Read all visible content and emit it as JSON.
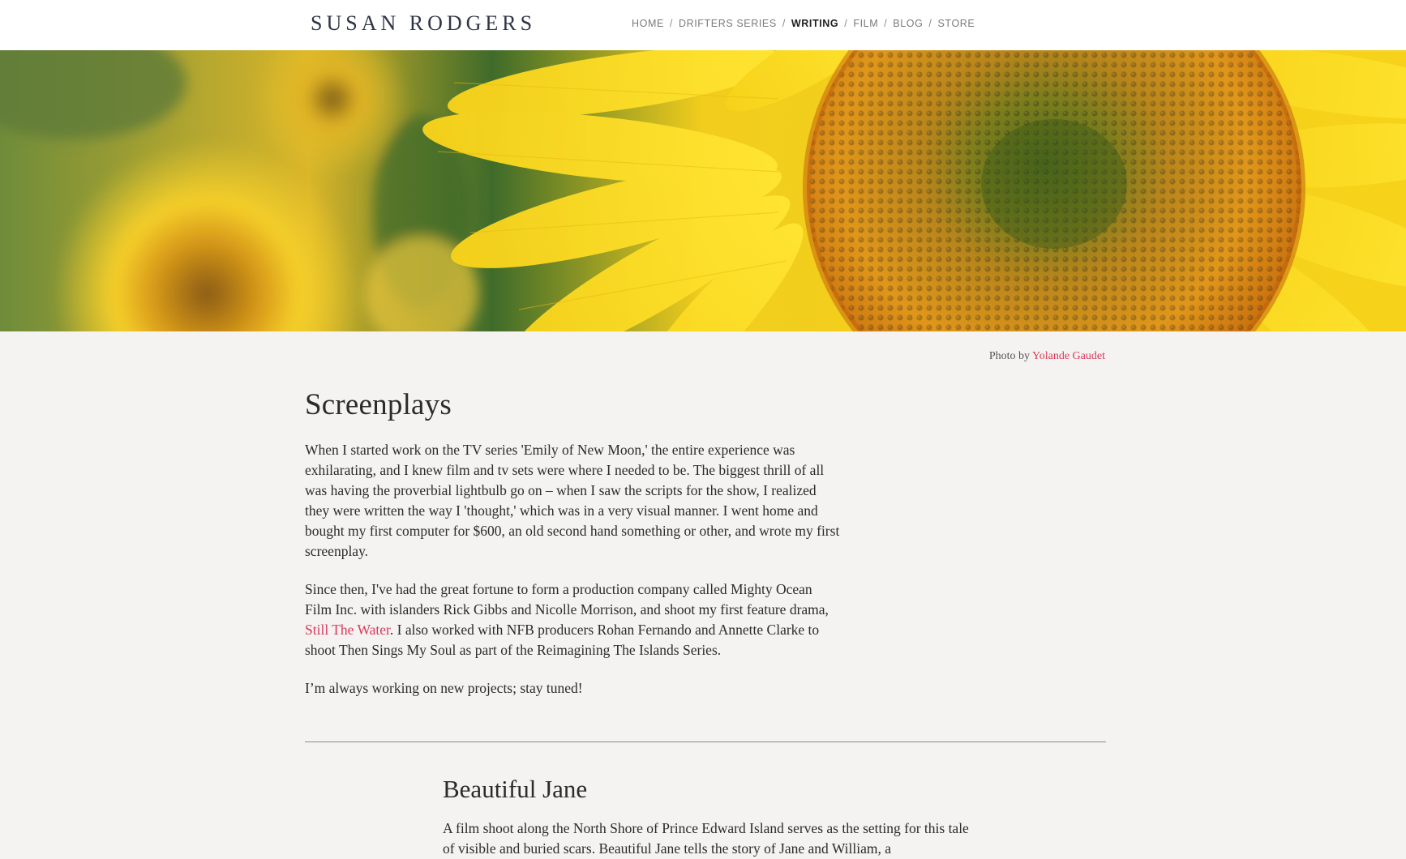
{
  "header": {
    "brand": "SUSAN RODGERS",
    "nav": [
      {
        "label": "HOME",
        "active": false
      },
      {
        "label": "DRIFTERS SERIES",
        "active": false
      },
      {
        "label": "WRITING",
        "active": true
      },
      {
        "label": "FILM",
        "active": false
      },
      {
        "label": "BLOG",
        "active": false
      },
      {
        "label": "STORE",
        "active": false
      }
    ],
    "separator": "/"
  },
  "hero": {
    "image": "sunflower-close-up"
  },
  "credit": {
    "prefix": "Photo by ",
    "author": "Yolande Gaudet"
  },
  "screenplays": {
    "title": "Screenplays",
    "p1": "When I started work on the TV series 'Emily of New Moon,' the entire experience was exhilarating, and I knew film and tv sets were where I needed to be. The biggest thrill of all was having the proverbial lightbulb go on – when I saw the scripts for the show, I realized they were written the way I 'thought,' which was in a very visual manner. I went home and bought my first computer for $600, an old second hand something or other, and wrote my first screenplay.",
    "p2_before": "Since then, I've had the great fortune to form a production company called Mighty Ocean Film Inc. with islanders Rick Gibbs and Nicolle Morrison, and shoot my first feature drama, ",
    "p2_link": "Still The Water",
    "p2_after": ". I also worked with NFB producers Rohan Fernando and Annette Clarke to shoot Then Sings My Soul as part of the Reimagining The Islands Series.",
    "p3": "I’m always working on new projects; stay tuned!"
  },
  "beautiful_jane": {
    "title": "Beautiful Jane",
    "text": "A film shoot along the North Shore of Prince Edward Island serves as the setting for this tale of visible and buried scars. Beautiful Jane tells the story of Jane and William, a"
  },
  "colors": {
    "accent": "#d8395b",
    "brand": "#2f3446",
    "background": "#f4f3f1"
  }
}
